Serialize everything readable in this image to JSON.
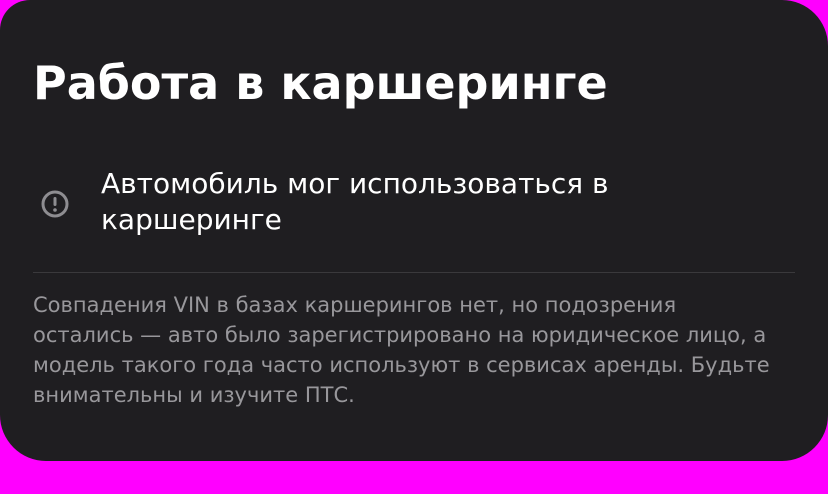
{
  "card": {
    "title": "Работа в каршеринге",
    "status": {
      "icon": "exclamation-circle-icon",
      "text": "Автомобиль мог использоваться в каршеринге"
    },
    "description": "Совпадения VIN в базах каршерингов нет, но подозрения остались — авто было зарегистрировано на юридическое лицо, а модель такого года часто используют в сервисах аренды. Будьте внимательны и изучите ПТС."
  },
  "colors": {
    "card_background": "#1f1e21",
    "page_background": "#ff00ff",
    "primary_text": "#ffffff",
    "secondary_text": "#98979b",
    "icon": "#8e8d91",
    "divider": "#3a393c"
  }
}
